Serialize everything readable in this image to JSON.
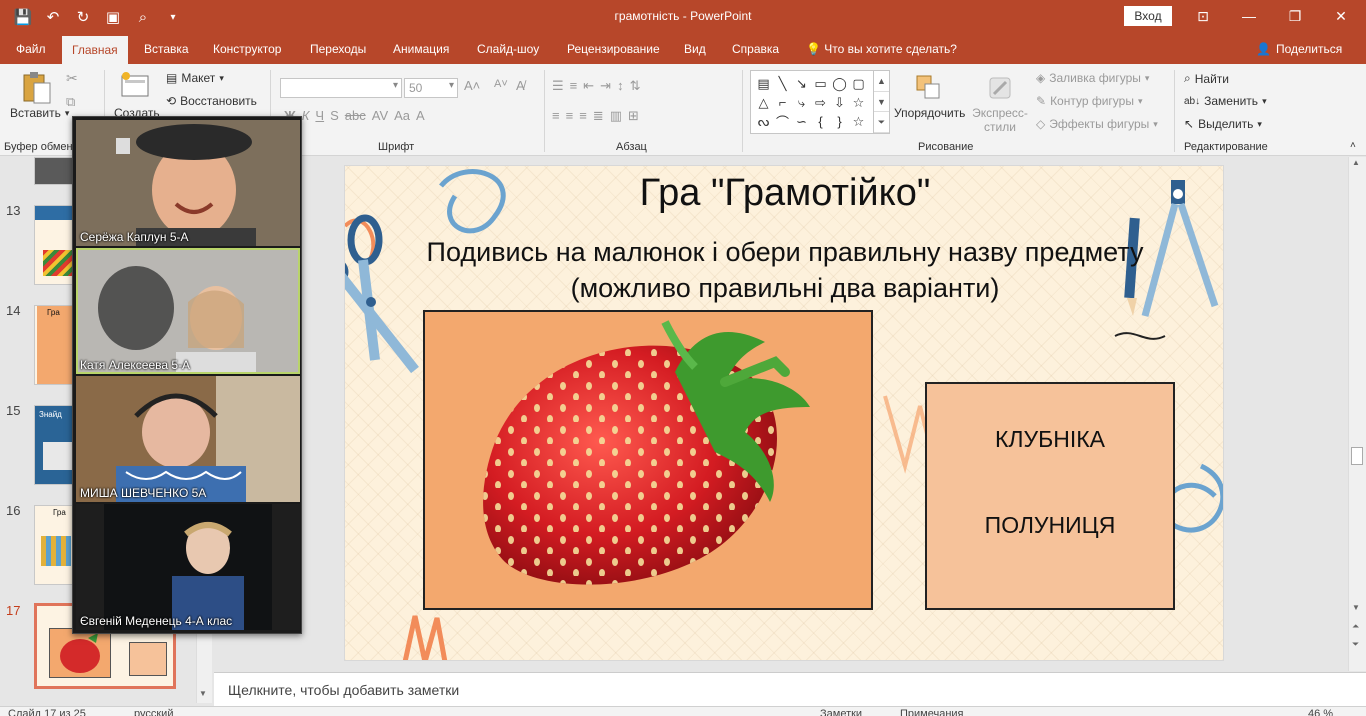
{
  "app": {
    "window_title": "грамотність  -  PowerPoint",
    "sign_in": "Вход"
  },
  "tabs": [
    "Файл",
    "Главная",
    "Вставка",
    "Конструктор",
    "Переходы",
    "Анимация",
    "Слайд-шоу",
    "Рецензирование",
    "Вид",
    "Справка"
  ],
  "tell_me": "Что вы хотите сделать?",
  "share": "Поделиться",
  "ribbon": {
    "clipboard": {
      "paste": "Вставить",
      "label": "Буфер обмен"
    },
    "slides": {
      "new_slide": "Создать",
      "layout": "Макет",
      "reset": "Восстановить"
    },
    "font": {
      "label": "Шрифт",
      "size": "50"
    },
    "paragraph": {
      "label": "Абзац"
    },
    "drawing": {
      "label": "Рисование",
      "arrange": "Упорядочить",
      "quick_styles": "Экспресс-стили",
      "shape_fill": "Заливка фигуры",
      "shape_outline": "Контур фигуры",
      "shape_effects": "Эффекты фигуры"
    },
    "editing": {
      "label": "Редактирование",
      "find": "Найти",
      "replace": "Заменить",
      "select": "Выделить"
    }
  },
  "thumbnails": [
    {
      "number": "13",
      "caption": ""
    },
    {
      "number": "14",
      "caption": "Гра"
    },
    {
      "number": "15",
      "caption": "Знайд"
    },
    {
      "number": "16",
      "caption": "Гра"
    },
    {
      "number": "17",
      "caption": ""
    }
  ],
  "video": {
    "participants": [
      {
        "name": "Серёжа Каплун 5-А"
      },
      {
        "name": "Катя Алексеева 5-А"
      },
      {
        "name": "МИША ШЕВЧЕНКО 5А"
      },
      {
        "name": "Євгеній Меденець 4-А клас"
      }
    ]
  },
  "slide": {
    "title": "Гра \"Грамотійко\"",
    "subtitle": "Подивись на малюнок і обери правильну назву предмету (можливо правильні два варіанти)",
    "answers": [
      "КЛУБНІКА",
      "ПОЛУНИЦЯ"
    ]
  },
  "notes": {
    "placeholder": "Щелкните, чтобы добавить заметки"
  },
  "status": {
    "slide_of": "Слайд 17 из 25",
    "language": "русский",
    "notes": "Заметки",
    "comments": "Примечания",
    "zoom": "46 %"
  },
  "colors": {
    "accent": "#b7472a",
    "ribbon_bg": "#f3f3f3",
    "slide_bg": "#fdf1dc",
    "image_box": "#f3a86e",
    "answer_box": "#f6c29a"
  }
}
